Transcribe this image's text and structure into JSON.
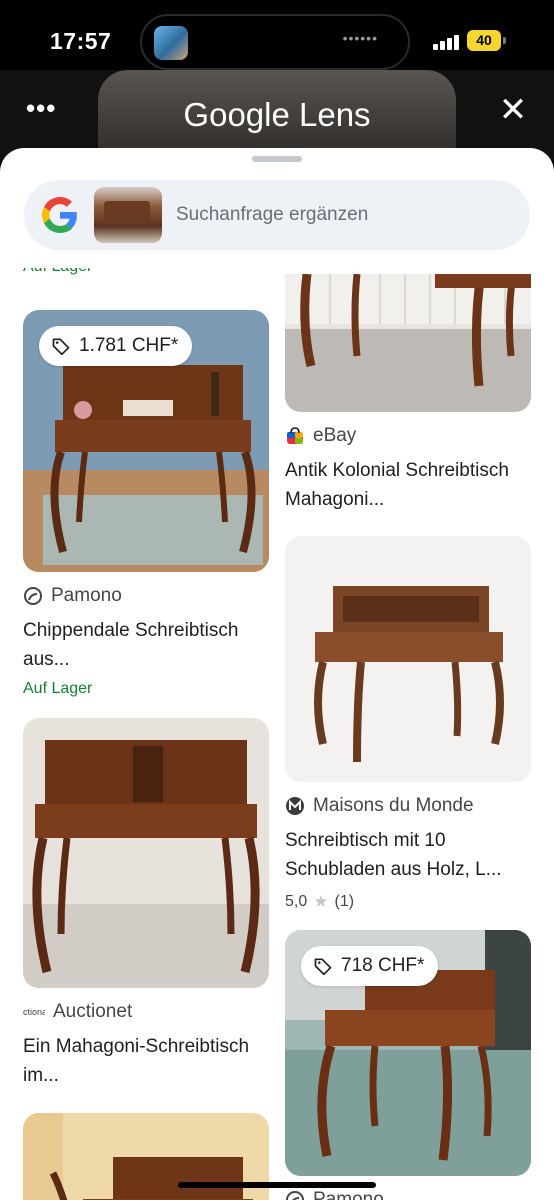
{
  "status": {
    "time": "17:57",
    "battery": "40",
    "island_dots": "••••••"
  },
  "header": {
    "menu": "•••",
    "title": "Google Lens",
    "close": "✕"
  },
  "search": {
    "placeholder": "Suchanfrage ergänzen"
  },
  "results": {
    "top_stock": "Auf Lager",
    "items": [
      {
        "price": "1.781 CHF*",
        "source": "Pamono",
        "title": "Chippendale Schreibtisch aus...",
        "stock": "Auf Lager"
      },
      {
        "source": "eBay",
        "title": "Antik Kolonial Schreibtisch Mahagoni..."
      },
      {
        "source": "Maisons du Monde",
        "title": "Schreibtisch mit 10 Schubladen aus Holz, L...",
        "rating": "5,0",
        "rating_count": "(1)"
      },
      {
        "source": "Auctionet",
        "source_prefix": "ctiona",
        "title": "Ein Mahagoni-Schreibtisch im..."
      },
      {
        "price": "718 CHF*",
        "source": "Pamono"
      }
    ]
  },
  "colors": {
    "accent_green": "#188038",
    "search_bg": "#eef1f5"
  }
}
